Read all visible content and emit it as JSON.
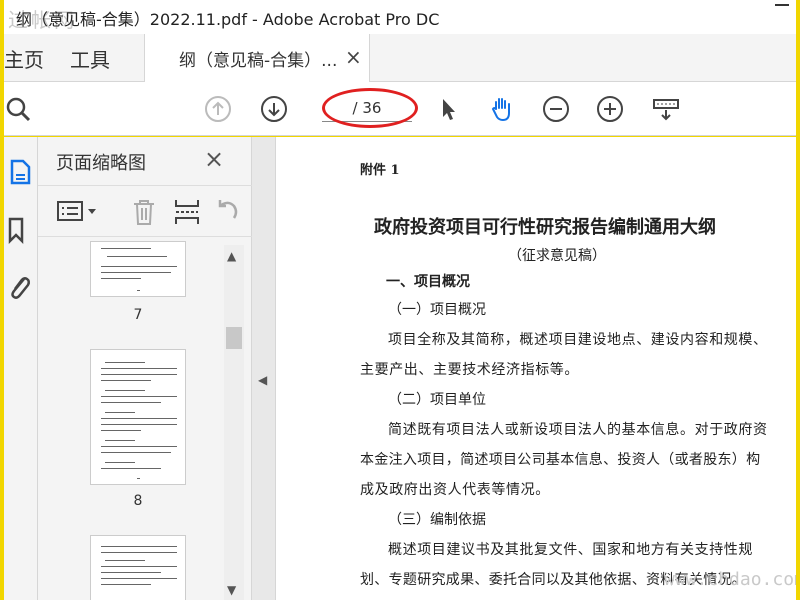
{
  "window": {
    "title": "纲（意见稿-合集）2022.11.pdf - Adobe Acrobat Pro DC",
    "watermark": "过帐网"
  },
  "menu": {
    "home": "主页",
    "tools": "工具",
    "doc_tab": "纲（意见稿-合集）...",
    "close_tab": "×"
  },
  "toolbar": {
    "page_indicator": "/ 36"
  },
  "thumbnails": {
    "header": "页面缩略图",
    "close": "×",
    "pages": [
      {
        "num": "7"
      },
      {
        "num": "8"
      }
    ]
  },
  "document": {
    "attach": "附件 1",
    "title": "政府投资项目可行性研究报告编制通用大纲",
    "subtitle": "（征求意见稿）",
    "section1": "一、项目概况",
    "s1_1": "（一）项目概况",
    "p1a": "项目全称及其简称，概述项目建设地点、建设内容和规模、",
    "p1b": "主要产出、主要技术经济指标等。",
    "s1_2": "（二）项目单位",
    "p2a": "简述既有项目法人或新设项目法人的基本信息。对于政府资",
    "p2b": "本金注入项目，简述项目公司基本信息、投资人（或者股东）构",
    "p2c": "成及政府出资人代表等情况。",
    "s1_3": "（三）编制依据",
    "p3a": "概述项目建议书及其批复文件、国家和地方有关支持性规",
    "p3b": "划、专题研究成果、委托合同以及其他依据、资料有关情况。",
    "watermark": "www.chdao.com"
  },
  "colors": {
    "frame": "#f1d600",
    "accent": "#1473e6",
    "highlight": "#e02020"
  }
}
